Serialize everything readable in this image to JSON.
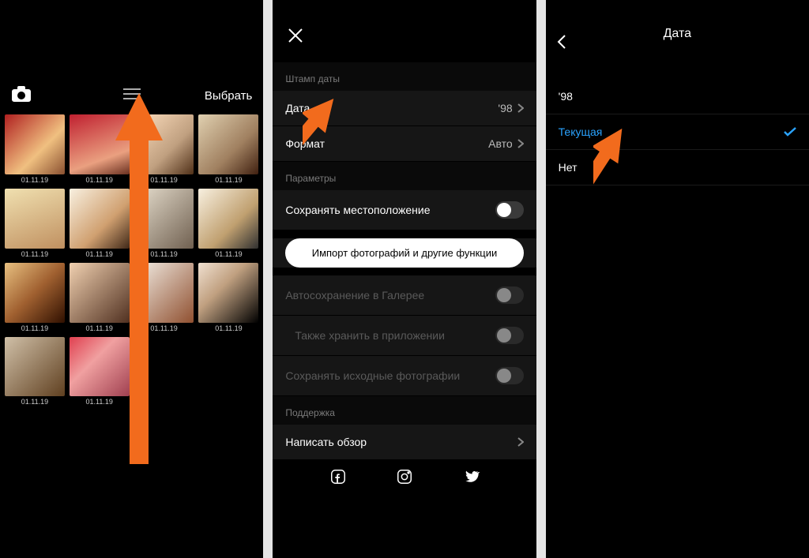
{
  "panel1": {
    "select_label": "Выбрать",
    "thumbs": [
      {
        "date": "01.11.19",
        "cls": "th1"
      },
      {
        "date": "01.11.19",
        "cls": "th2"
      },
      {
        "date": "01.11.19",
        "cls": "th3"
      },
      {
        "date": "01.11.19",
        "cls": "th4"
      },
      {
        "date": "01.11.19",
        "cls": "th5"
      },
      {
        "date": "01.11.19",
        "cls": "th6"
      },
      {
        "date": "01.11.19",
        "cls": "th7"
      },
      {
        "date": "01.11.19",
        "cls": "th8"
      },
      {
        "date": "01.11.19",
        "cls": "th9"
      },
      {
        "date": "01.11.19",
        "cls": "th10"
      },
      {
        "date": "01.11.19",
        "cls": "th11"
      },
      {
        "date": "01.11.19",
        "cls": "th12"
      },
      {
        "date": "01.11.19",
        "cls": "th13"
      },
      {
        "date": "01.11.19",
        "cls": "th14"
      }
    ]
  },
  "panel2": {
    "section_stamp": "Штамп даты",
    "row_date_label": "Дата",
    "row_date_value": "'98",
    "row_format_label": "Формат",
    "row_format_value": "Авто",
    "section_params": "Параметры",
    "row_save_location": "Сохранять местоположение",
    "import_button": "Импорт фотографий и другие функции",
    "row_autosave": "Автосохранение в Галерее",
    "row_also_store": "Также хранить в приложении",
    "row_save_originals": "Сохранять исходные фотографии",
    "section_support": "Поддержка",
    "row_review": "Написать обзор"
  },
  "panel3": {
    "title": "Дата",
    "opt_98": "'98",
    "opt_current": "Текущая",
    "opt_none": "Нет"
  }
}
